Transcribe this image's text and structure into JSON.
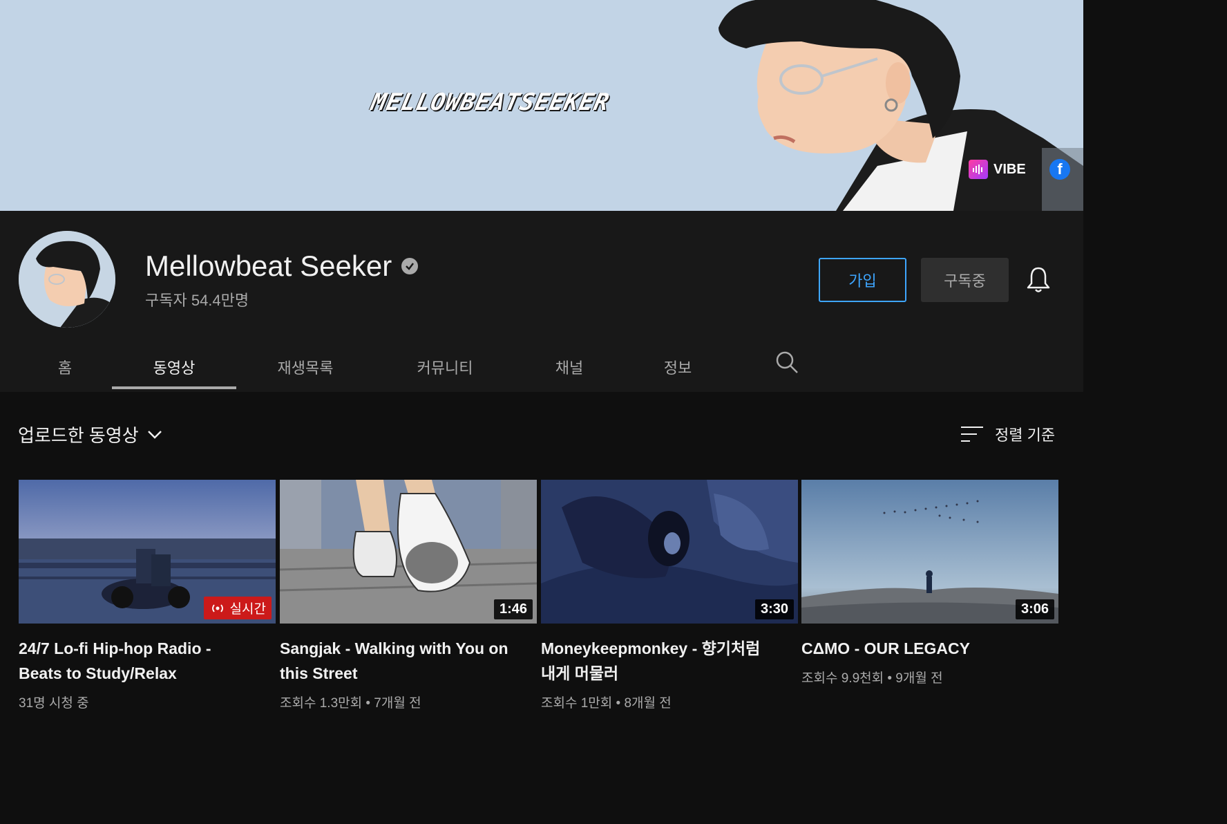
{
  "banner": {
    "title": "MELLOWBEATSEEKER",
    "links": [
      {
        "label": "VIBE",
        "icon": "vibe-icon"
      },
      {
        "label": "",
        "icon": "facebook-icon"
      }
    ]
  },
  "channel": {
    "name": "Mellowbeat Seeker",
    "subscribers": "구독자 54.4만명",
    "join_label": "가입",
    "subscribed_label": "구독중"
  },
  "tabs": [
    {
      "label": "홈"
    },
    {
      "label": "동영상"
    },
    {
      "label": "재생목록"
    },
    {
      "label": "커뮤니티"
    },
    {
      "label": "채널"
    },
    {
      "label": "정보"
    }
  ],
  "active_tab": "동영상",
  "section": {
    "title": "업로드한 동영상",
    "sort_label": "정렬 기준"
  },
  "videos": [
    {
      "title": "24/7 Lo-fi Hip-hop Radio - Beats to Study/Relax",
      "badge": "실시간",
      "meta": "31명 시청 중"
    },
    {
      "title": "Sangjak - Walking with You on this Street",
      "duration": "1:46",
      "meta": "조회수 1.3만회 • 7개월 전"
    },
    {
      "title": "Moneykeepmonkey - 향기처럼 내게 머물러",
      "duration": "3:30",
      "meta": "조회수 1만회 • 8개월 전"
    },
    {
      "title": "CΔMO - OUR LEGACY",
      "duration": "3:06",
      "meta": "조회수 9.9천회 • 9개월 전"
    }
  ],
  "colors": {
    "accent_blue": "#3ea6ff",
    "live_red": "#cc1a1a",
    "banner_bg": "#c2d4e6",
    "header_bg": "#181818",
    "page_bg": "#0f0f0f"
  }
}
